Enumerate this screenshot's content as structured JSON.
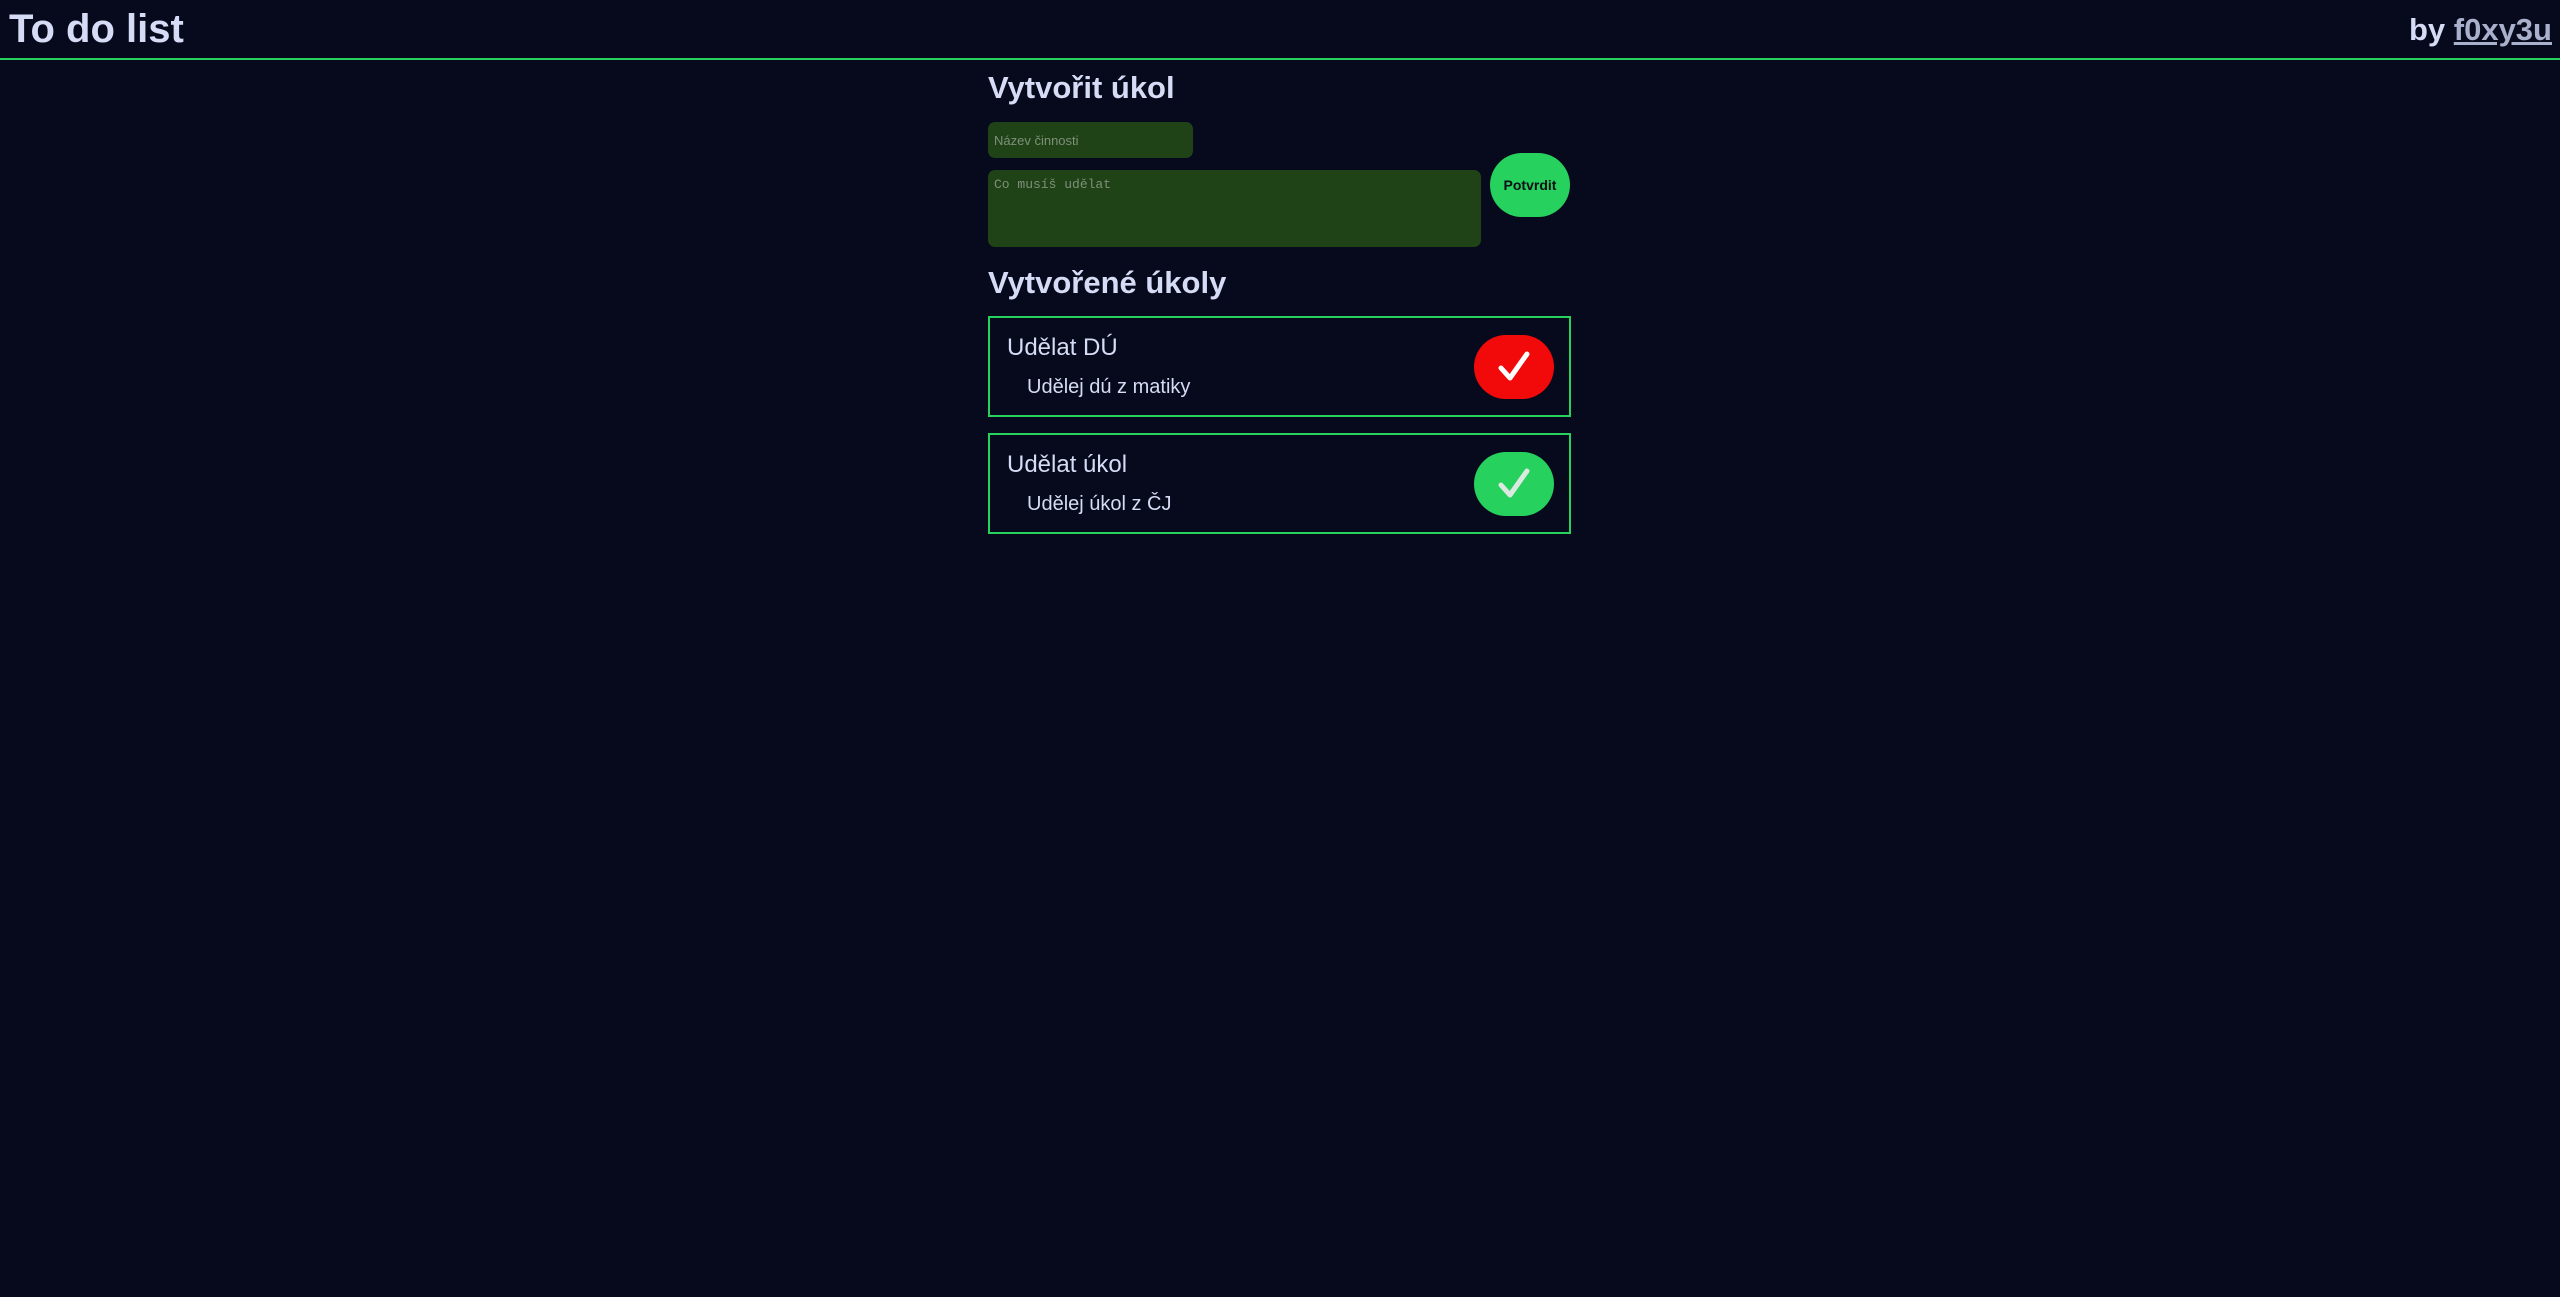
{
  "header": {
    "title": "To do list",
    "author_prefix": "by",
    "author_name": "f0xy3u"
  },
  "create": {
    "heading": "Vytvořit úkol",
    "name_placeholder": "Název činnosti",
    "name_value": "",
    "description_placeholder": "Co musíš udělat",
    "description_value": "",
    "confirm_label": "Potvrdit"
  },
  "created": {
    "heading": "Vytvořené úkoly",
    "tasks": [
      {
        "title": "Udělat DÚ",
        "description": "Udělej dú z matiky",
        "button_icon": "check-icon",
        "button_color": "#f20a0a"
      },
      {
        "title": "Udělat úkol",
        "description": "Udělej úkol z ČJ",
        "button_icon": "check-icon",
        "button_color": "#26d15e"
      }
    ]
  },
  "colors": {
    "background": "#060a1c",
    "accent": "#26d15e",
    "input_background": "#1f4316",
    "text": "#d6dcf5",
    "link": "#a9b0cc"
  }
}
